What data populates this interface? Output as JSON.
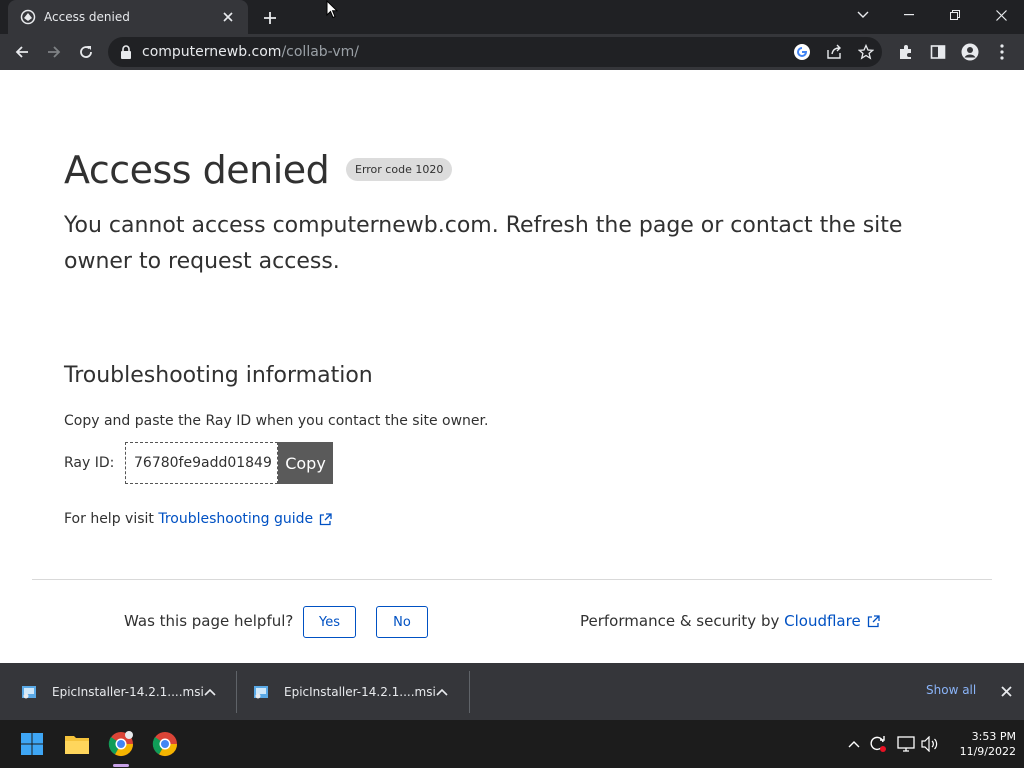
{
  "browser": {
    "tab_title": "Access denied",
    "url_host": "computernewb.com",
    "url_path": "/collab-vm/"
  },
  "page": {
    "heading": "Access denied",
    "error_badge": "Error code 1020",
    "subtitle": "You cannot access computernewb.com. Refresh the page or contact the site owner to request access.",
    "troubleshooting_heading": "Troubleshooting information",
    "copy_instructions": "Copy and paste the Ray ID when you contact the site owner.",
    "ray_label": "Ray ID:",
    "ray_id": "76780fe9add01849",
    "copy_button": "Copy",
    "help_prefix": "For help visit",
    "help_link": "Troubleshooting guide",
    "helpful_question": "Was this page helpful?",
    "yes_button": "Yes",
    "no_button": "No",
    "perf_prefix": "Performance & security by",
    "perf_link": "Cloudflare"
  },
  "downloads": {
    "items": [
      {
        "name": "EpicInstaller-14.2.1....msi"
      },
      {
        "name": "EpicInstaller-14.2.1....msi"
      }
    ],
    "show_all": "Show all"
  },
  "taskbar": {
    "time": "3:53 PM",
    "date": "11/9/2022"
  },
  "colors": {
    "link": "#0051c3",
    "chrome_dark": "#202124",
    "chrome_toolbar": "#35363a"
  }
}
